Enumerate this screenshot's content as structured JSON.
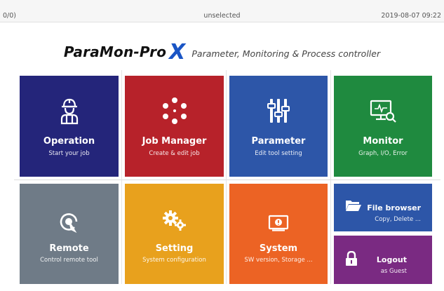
{
  "status_bar": {
    "left": "0/0)",
    "center": "unselected",
    "right": "2019-08-07 09:22"
  },
  "header": {
    "brand": "ParaMon-Pro",
    "brand_x": "X",
    "tagline": "Parameter, Monitoring & Process controller"
  },
  "tiles": {
    "operation": {
      "title": "Operation",
      "subtitle": "Start your job",
      "icon": "worker-icon",
      "color": "#24257a"
    },
    "job_manager": {
      "title": "Job Manager",
      "subtitle": "Create & edit job",
      "icon": "nodes-circle-icon",
      "color": "#b7222a"
    },
    "parameter": {
      "title": "Parameter",
      "subtitle": "Edit tool setting",
      "icon": "sliders-icon",
      "color": "#2d56a8"
    },
    "monitor": {
      "title": "Monitor",
      "subtitle": "Graph, I/O, Error",
      "icon": "monitor-search-icon",
      "color": "#1f8a3f"
    },
    "remote": {
      "title": "Remote",
      "subtitle": "Control remote tool",
      "icon": "remote-touch-icon",
      "color": "#6f7b87"
    },
    "setting": {
      "title": "Setting",
      "subtitle": "System configuration",
      "icon": "gears-icon",
      "color": "#e8a11d"
    },
    "system": {
      "title": "System",
      "subtitle": "SW version, Storage ...",
      "icon": "screen-alert-icon",
      "color": "#ec6324"
    },
    "file_browser": {
      "title": "File browser",
      "subtitle": "Copy, Delete ...",
      "icon": "folder-open-icon",
      "color": "#2d56a8"
    },
    "logout": {
      "title": "Logout",
      "subtitle": "as Guest",
      "icon": "lock-icon",
      "color": "#7a2a82"
    }
  }
}
